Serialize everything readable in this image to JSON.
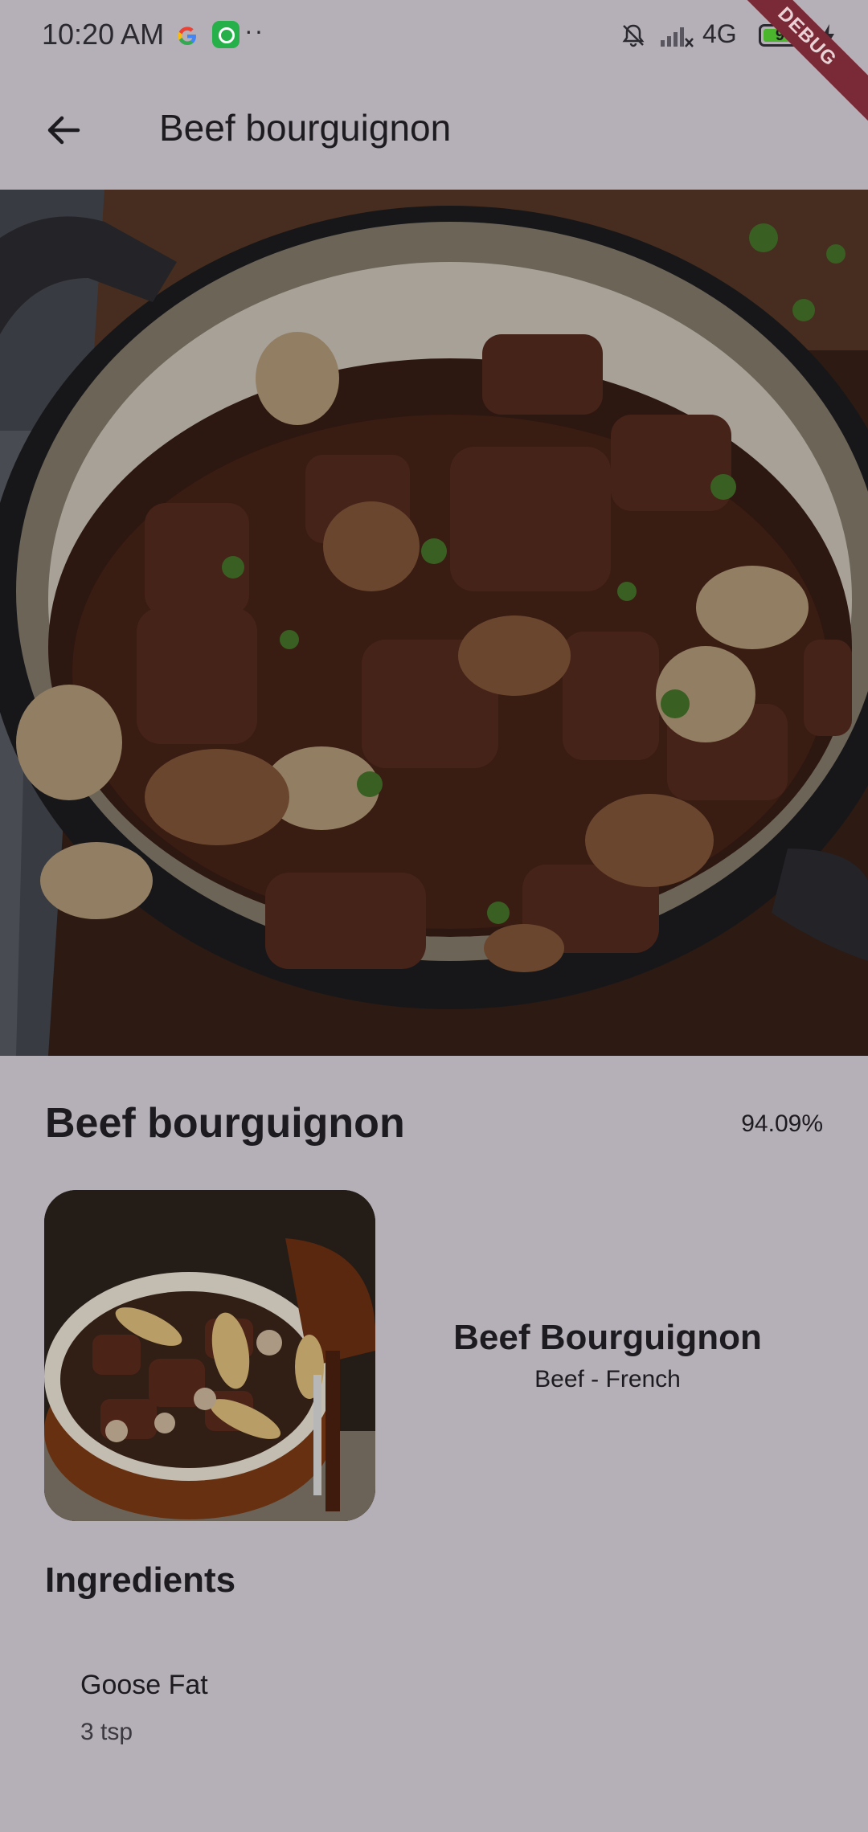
{
  "status_bar": {
    "time": "10:20 AM",
    "network": "4G",
    "battery": "90",
    "battery_level": 0.9,
    "debug_label": "DEBUG"
  },
  "app_bar": {
    "title": "Beef bourguignon",
    "back_icon": "arrow-back-icon"
  },
  "recipe": {
    "title": "Beef bourguignon",
    "match": "94.09%",
    "meal_name": "Beef Bourguignon",
    "meal_category": "Beef - French"
  },
  "ingredients_section": {
    "title": "Ingredients",
    "items": [
      {
        "name": "Goose Fat",
        "quantity": "3 tsp"
      }
    ]
  }
}
